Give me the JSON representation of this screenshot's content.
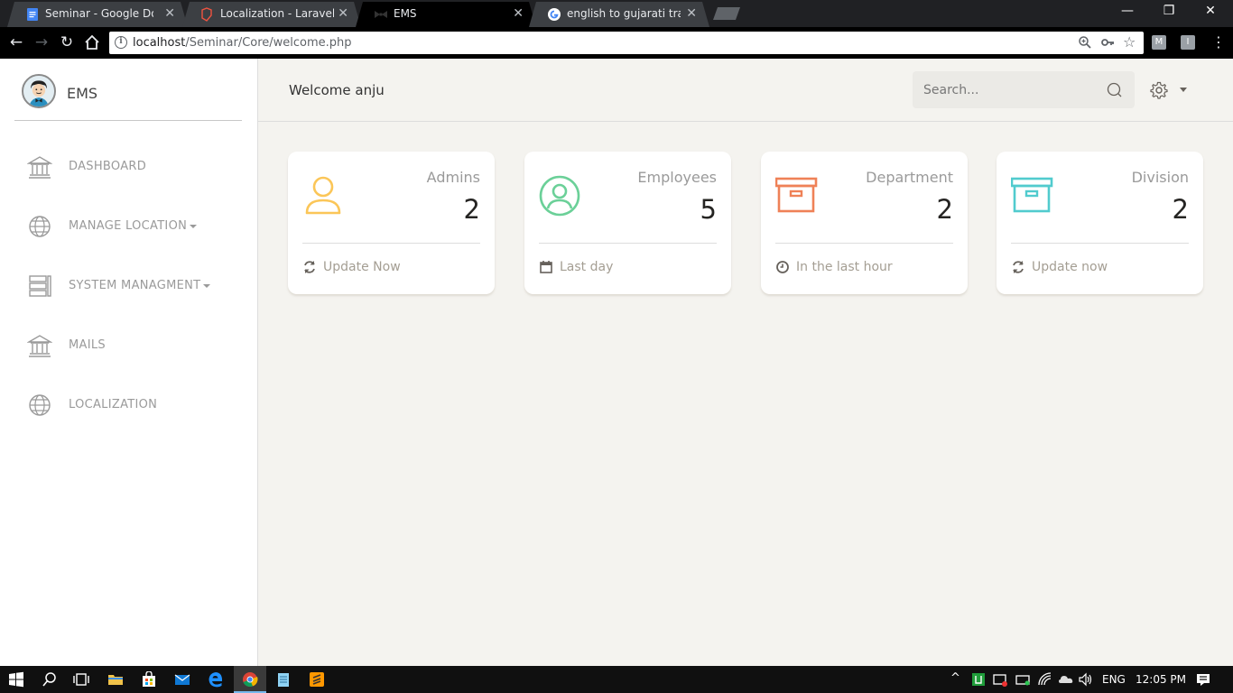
{
  "browser": {
    "tabs": [
      {
        "title": "Seminar - Google Docs"
      },
      {
        "title": "Localization - Laravel - Th"
      },
      {
        "title": "EMS"
      },
      {
        "title": "english to gujarati transla"
      }
    ],
    "url_host": "localhost",
    "url_path": "/Seminar/Core/welcome.php",
    "extensions": [
      "M",
      "I"
    ]
  },
  "sidebar": {
    "brand": "EMS",
    "items": [
      {
        "label": "DASHBOARD",
        "icon": "bank-icon",
        "dropdown": false
      },
      {
        "label": "MANAGE LOCATION",
        "icon": "globe-icon",
        "dropdown": true
      },
      {
        "label": "SYSTEM MANAGMENT",
        "icon": "server-icon",
        "dropdown": true
      },
      {
        "label": "MAILS",
        "icon": "bank-icon",
        "dropdown": false
      },
      {
        "label": "LOCALIZATION",
        "icon": "globe-icon",
        "dropdown": false
      }
    ]
  },
  "topbar": {
    "welcome": "Welcome anju",
    "search_placeholder": "Search..."
  },
  "cards": [
    {
      "label": "Admins",
      "value": "2",
      "footer": "Update Now",
      "icon": "user-icon",
      "footer_icon": "refresh-icon",
      "color": "#fbc658"
    },
    {
      "label": "Employees",
      "value": "5",
      "footer": "Last day",
      "icon": "user-circle-icon",
      "footer_icon": "calendar-icon",
      "color": "#6bd098"
    },
    {
      "label": "Department",
      "value": "2",
      "footer": "In the last hour",
      "icon": "archive-icon",
      "footer_icon": "clock-icon",
      "color": "#ef8157"
    },
    {
      "label": "Division",
      "value": "2",
      "footer": "Update now",
      "icon": "archive-icon",
      "footer_icon": "refresh-icon",
      "color": "#51cbce"
    }
  ],
  "taskbar": {
    "language": "ENG",
    "time": "12:05 PM"
  }
}
